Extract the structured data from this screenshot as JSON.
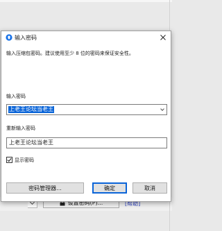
{
  "dialog": {
    "title": "输入密码",
    "instruction": "输入压缩包密码。建议使用至少 8 位的密码来保证安全性。",
    "password_label": "输入密码",
    "password_value": "上老王论坛当老王",
    "reenter_label": "重新输入密码",
    "reenter_value": "上老王论坛当老王",
    "show_password_label": "显示密码",
    "show_password_checked": true,
    "buttons": {
      "manager": "密码管理器...",
      "ok": "确定",
      "cancel": "取消"
    }
  },
  "background": {
    "set_password_button": "设置密码(P)...",
    "help_link": "[帮助]"
  },
  "colors": {
    "accent": "#0a64d8",
    "app_icon": "#1a73e8",
    "help_link": "#2a3fc0"
  },
  "icons": {
    "app": "app-icon",
    "close": "close-icon",
    "dropdown": "chevron-down-icon",
    "check": "check-icon",
    "lock": "lock-icon"
  }
}
